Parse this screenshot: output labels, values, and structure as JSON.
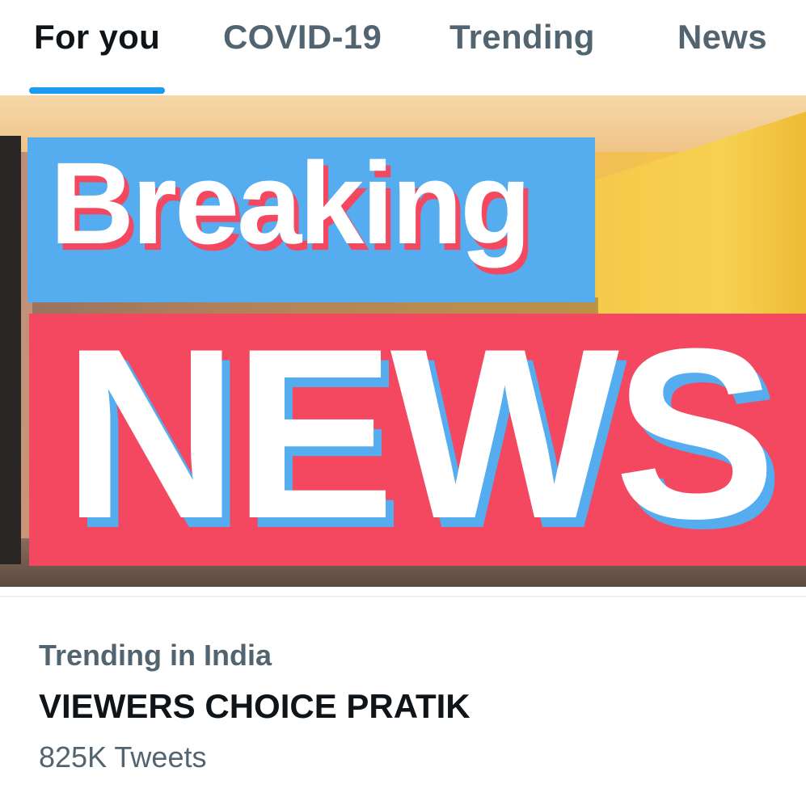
{
  "tabs": [
    {
      "label": "For you",
      "active": true
    },
    {
      "label": "COVID-19",
      "active": false
    },
    {
      "label": "Trending",
      "active": false
    },
    {
      "label": "News",
      "active": false
    }
  ],
  "colors": {
    "accent": "#1d9bf0",
    "text_primary": "#0f1419",
    "text_secondary": "#536471",
    "breaking_blue": "#55acee",
    "news_red": "#f3485f"
  },
  "hero": {
    "headline_line1": "Breaking",
    "headline_line2": "NEWS"
  },
  "trend": {
    "context": "Trending in India",
    "title": "VIEWERS CHOICE PRATIK",
    "count": "825K Tweets"
  }
}
